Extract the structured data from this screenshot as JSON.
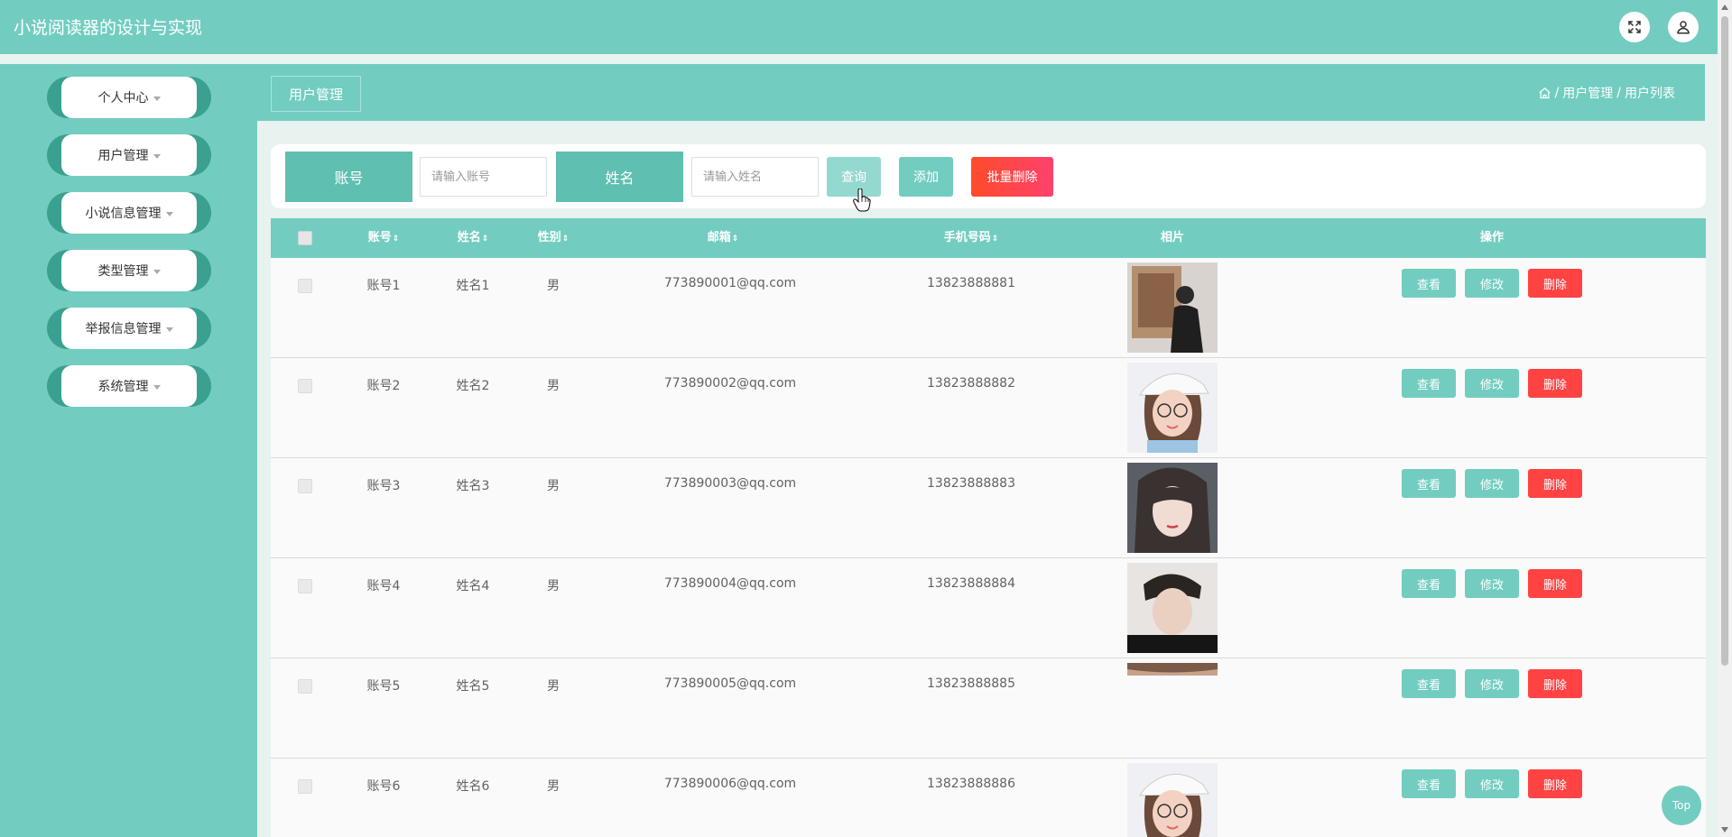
{
  "header": {
    "title": "小说阅读器的设计与实现",
    "fullscreen_icon": "fullscreen-icon",
    "user_icon": "user-icon"
  },
  "sidebar": {
    "items": [
      {
        "label": "个人中心"
      },
      {
        "label": "用户管理"
      },
      {
        "label": "小说信息管理"
      },
      {
        "label": "类型管理"
      },
      {
        "label": "举报信息管理"
      },
      {
        "label": "系统管理"
      }
    ]
  },
  "breadcrumb": {
    "tab": "用户管理",
    "sep": "/",
    "path": [
      "用户管理",
      "用户列表"
    ]
  },
  "search": {
    "account_label": "账号",
    "account_placeholder": "请输入账号",
    "name_label": "姓名",
    "name_placeholder": "请输入姓名",
    "search_button": "查询",
    "add_button": "添加",
    "batch_delete_button": "批量删除"
  },
  "table": {
    "headers": {
      "account": "账号",
      "name": "姓名",
      "gender": "性别",
      "email": "邮箱",
      "phone": "手机号码",
      "photo": "相片",
      "actions": "操作",
      "sort_glyph": "⇕"
    },
    "action_labels": {
      "view": "查看",
      "edit": "修改",
      "delete": "删除"
    },
    "rows": [
      {
        "account": "账号1",
        "name": "姓名1",
        "gender": "男",
        "email": "773890001@qq.com",
        "phone": "13823888881"
      },
      {
        "account": "账号2",
        "name": "姓名2",
        "gender": "男",
        "email": "773890002@qq.com",
        "phone": "13823888882"
      },
      {
        "account": "账号3",
        "name": "姓名3",
        "gender": "男",
        "email": "773890003@qq.com",
        "phone": "13823888883"
      },
      {
        "account": "账号4",
        "name": "姓名4",
        "gender": "男",
        "email": "773890004@qq.com",
        "phone": "13823888884"
      },
      {
        "account": "账号5",
        "name": "姓名5",
        "gender": "男",
        "email": "773890005@qq.com",
        "phone": "13823888885"
      },
      {
        "account": "账号6",
        "name": "姓名6",
        "gender": "男",
        "email": "773890006@qq.com",
        "phone": "13823888886"
      }
    ]
  },
  "top_button": "Top",
  "colors": {
    "primary": "#72cdc0",
    "danger": "#ff4343",
    "label_bg": "#5fbfb0"
  }
}
